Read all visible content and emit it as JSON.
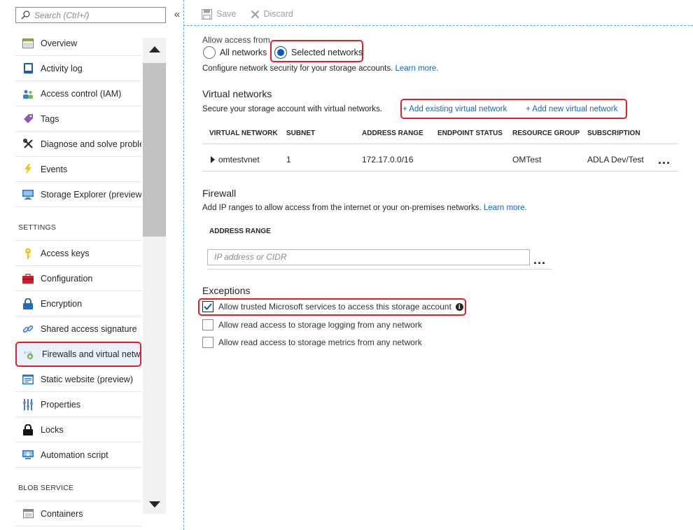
{
  "sidebar": {
    "search_placeholder": "Search (Ctrl+/)",
    "collapse_glyph": "«",
    "items_top": [
      {
        "label": "Overview",
        "icon": "overview-icon"
      },
      {
        "label": "Activity log",
        "icon": "activity-log-icon"
      },
      {
        "label": "Access control (IAM)",
        "icon": "iam-icon"
      },
      {
        "label": "Tags",
        "icon": "tag-icon"
      },
      {
        "label": "Diagnose and solve problems",
        "icon": "wrench-icon"
      },
      {
        "label": "Events",
        "icon": "lightning-icon"
      },
      {
        "label": "Storage Explorer (preview)",
        "icon": "storage-explorer-icon"
      }
    ],
    "settings_header": "SETTINGS",
    "items_settings": [
      {
        "label": "Access keys",
        "icon": "key-icon"
      },
      {
        "label": "Configuration",
        "icon": "briefcase-icon"
      },
      {
        "label": "Encryption",
        "icon": "lock-blue-icon"
      },
      {
        "label": "Shared access signature",
        "icon": "link-icon"
      },
      {
        "label": "Firewalls and virtual networks",
        "icon": "firewall-icon"
      },
      {
        "label": "Static website (preview)",
        "icon": "static-website-icon"
      },
      {
        "label": "Properties",
        "icon": "properties-icon"
      },
      {
        "label": "Locks",
        "icon": "lock-icon"
      },
      {
        "label": "Automation script",
        "icon": "automation-icon"
      }
    ],
    "blob_header": "BLOB SERVICE",
    "items_blob": [
      {
        "label": "Containers",
        "icon": "containers-icon"
      }
    ]
  },
  "toolbar": {
    "save_label": "Save",
    "discard_label": "Discard"
  },
  "access": {
    "label": "Allow access from",
    "option_all": "All networks",
    "option_selected": "Selected networks",
    "selected": "Selected networks",
    "config_text": "Configure network security for your storage accounts.",
    "learn_more": "Learn more."
  },
  "vnets": {
    "title": "Virtual networks",
    "desc": "Secure your storage account with virtual networks.",
    "add_existing": "+ Add existing virtual network",
    "add_new": "+ Add new virtual network",
    "columns": [
      "VIRTUAL NETWORK",
      "SUBNET",
      "ADDRESS RANGE",
      "ENDPOINT STATUS",
      "RESOURCE GROUP",
      "SUBSCRIPTION"
    ],
    "rows": [
      {
        "network": "omtestvnet",
        "subnet": "1",
        "address_range": "172.17.0.0/16",
        "endpoint_status": "",
        "resource_group": "OMTest",
        "subscription": "ADLA Dev/Test"
      }
    ],
    "more": "..."
  },
  "firewall": {
    "title": "Firewall",
    "desc": "Add IP ranges to allow access from the internet or your on-premises networks.",
    "learn_more": "Learn more.",
    "column": "ADDRESS RANGE",
    "input_placeholder": "IP address or CIDR",
    "more": "..."
  },
  "exceptions": {
    "title": "Exceptions",
    "items": [
      {
        "label": "Allow trusted Microsoft services to access this storage account",
        "checked": true
      },
      {
        "label": "Allow read access to storage logging from any network",
        "checked": false
      },
      {
        "label": "Allow read access to storage metrics from any network",
        "checked": false
      }
    ],
    "info_glyph": "i"
  },
  "colors": {
    "accent": "#0a59c2",
    "link": "#0a68c7",
    "highlight": "#e0202a"
  }
}
